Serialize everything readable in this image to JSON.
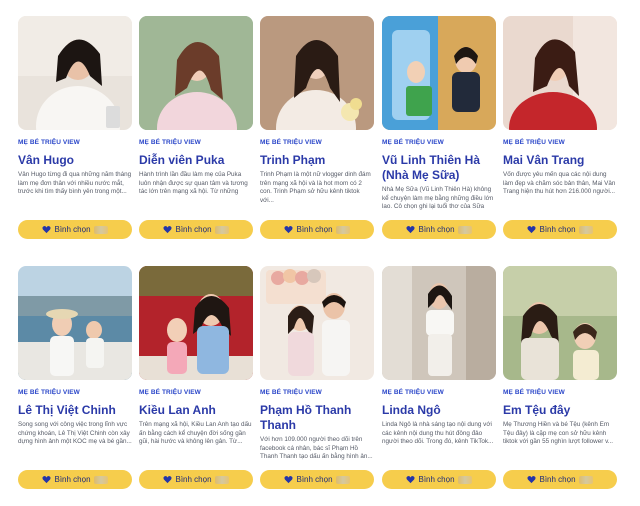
{
  "cards": [
    {
      "category": "Mẹ bé triệu view",
      "name": "Vân Hugo",
      "desc": "Vân Hugo từng đi qua những năm tháng làm mẹ đơn thân với nhiều nước mắt, trước khi tìm thấy bình yên trong một...",
      "vote_label": "Bình chọn",
      "photo_icon": "woman-white-dress-photo"
    },
    {
      "category": "Mẹ bé triệu view",
      "name": "Diễn viên Puka",
      "desc": "Hành trình lần đầu làm mẹ của Puka luôn nhận được sự quan tâm và tương tác lớn trên mạng xã hội. Từ những chi...",
      "vote_label": "Bình chọn",
      "photo_icon": "woman-pink-outfit-photo"
    },
    {
      "category": "Mẹ bé triệu view",
      "name": "Trinh Phạm",
      "desc": "Trinh Phạm là một nữ vlogger dinh đám trên mạng xã hội và là hot mom có 2 con. Trinh Phạm sở hữu kênh tiktok với...",
      "vote_label": "Bình chọn",
      "photo_icon": "woman-holding-flowers-photo"
    },
    {
      "category": "Mẹ bé triệu view",
      "name": "Vũ Linh Thiên Hà (Nhà Mẹ Sữa)",
      "desc": "Nhà Mẹ Sữa (Vũ Linh Thiên Hà) không kể chuyện làm mẹ bằng những điều lớn lao. Cô chọn ghi lại tuổi thơ của Sữa từ...",
      "vote_label": "Bình chọn",
      "photo_icon": "children-playhouse-photo"
    },
    {
      "category": "Mẹ bé triệu view",
      "name": "Mai Vân Trang",
      "desc": "Vốn được yêu mến qua các nội dung làm đẹp và chăm sóc bản thân, Mai Vân Trang hiện thu hút hơn 216.000 người...",
      "vote_label": "Bình chọn",
      "photo_icon": "woman-red-dress-photo"
    },
    {
      "category": "Mẹ bé triệu view",
      "name": "Lê Thị Việt Chinh",
      "desc": "Song song với công việc trong lĩnh vực chứng khoán, Lê Thị Việt Chinh còn xây dựng hình ảnh một KOC mẹ và bé gần...",
      "vote_label": "Bình chọn",
      "photo_icon": "mother-child-boat-photo"
    },
    {
      "category": "Mẹ bé triệu view",
      "name": "Kiều Lan Anh",
      "desc": "Trên mạng xã hội, Kiều Lan Anh tạo dấu ấn bằng cách kể chuyện đời sống gần gũi, hài hước và không lên gân. Từ...",
      "vote_label": "Bình chọn",
      "photo_icon": "mother-daughter-red-backdrop-photo"
    },
    {
      "category": "Mẹ bé triệu view",
      "name": "Phạm Hồ Thanh Thanh",
      "desc": "Với hơn 109.000 người theo dõi trên facebook cá nhân, bác sĩ Phạm Hồ Thanh Thanh tạo dấu ấn bằng hình ản...",
      "vote_label": "Bình chọn",
      "photo_icon": "family-party-photo"
    },
    {
      "category": "Mẹ bé triệu view",
      "name": "Linda Ngô",
      "desc": "Linda Ngô là nhà sáng tạo nội dung với các kênh nội dung thu hút đông đảo người theo dõi. Trong đó, kênh TikTok...",
      "vote_label": "Bình chọn",
      "photo_icon": "woman-white-top-photo"
    },
    {
      "category": "Mẹ bé triệu view",
      "name": "Em Tệu đây",
      "desc": "Mẹ Thương Hiền và bé Tệu (kênh Em Tệu đây) là cặp mẹ con sở hữu kênh tiktok với gần 55 nghìn lượt follower v...",
      "vote_label": "Bình chọn",
      "photo_icon": "mother-daughter-garden-photo"
    }
  ],
  "colors": {
    "accent": "#2b3aa8",
    "button": "#f6cd4c",
    "category": "#2b47c9"
  }
}
